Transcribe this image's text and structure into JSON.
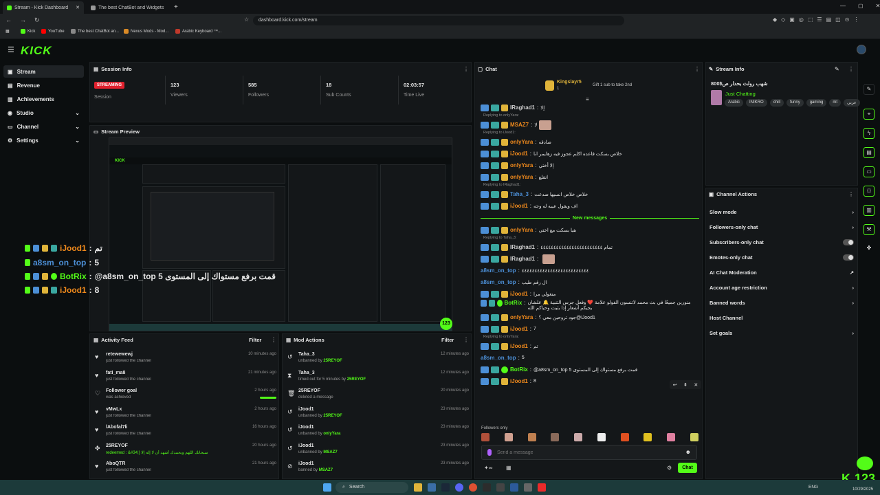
{
  "browser": {
    "tabs": [
      {
        "label": "Stream - Kick Dashboard"
      },
      {
        "label": "The best ChatBot and Widgets for Ki"
      }
    ],
    "url": "dashboard.kick.com/stream",
    "bookmarks": [
      "Kick",
      "YouTube",
      "The best ChatBot an...",
      "Nexus Mods - Mod...",
      "Arabic Keyboard ™..."
    ]
  },
  "app": {
    "logo": "KICK"
  },
  "sidebar": {
    "items": [
      {
        "label": "Stream"
      },
      {
        "label": "Revenue"
      },
      {
        "label": "Achievements"
      },
      {
        "label": "Studio"
      },
      {
        "label": "Channel"
      },
      {
        "label": "Settings"
      }
    ]
  },
  "session": {
    "title": "Session Info",
    "status": "STREAMING",
    "status_label": "Session",
    "stats": [
      {
        "value": "123",
        "label": "Viewers"
      },
      {
        "value": "585",
        "label": "Followers"
      },
      {
        "value": "18",
        "label": "Sub Counts"
      },
      {
        "value": "02:03:57",
        "label": "Time Live"
      }
    ]
  },
  "preview": {
    "title": "Stream Preview",
    "viewer_count": "123"
  },
  "overlay": [
    {
      "user": "iJood1",
      "text": "تم"
    },
    {
      "user": "a8sm_on_top",
      "text": "5"
    },
    {
      "user": "BotRix",
      "text": "@a8sm_on_top 5 قمت برفع مستواك إلى المستوى"
    },
    {
      "user": "iJood1",
      "text": "8"
    }
  ],
  "activity": {
    "title": "Activity Feed",
    "filter": "Filter",
    "items": [
      {
        "name": "retewewewj",
        "sub": "just followed the channel",
        "time": "10 minutes ago"
      },
      {
        "name": "fati_ma8",
        "sub": "just followed the channel",
        "time": "21 minutes ago"
      },
      {
        "name": "Follower goal",
        "sub": "was achieved",
        "time": "2 hours ago"
      },
      {
        "name": "vMwLx",
        "sub": "just followed the channel",
        "time": "2 hours ago"
      },
      {
        "name": "lAbofal7li",
        "sub": "just followed the channel",
        "time": "16 hours ago"
      },
      {
        "name": "25REYOF",
        "sub": "redeemed : &#34;} سبحانك اللهم وبحمدك أشهد أن لا إله إلا",
        "time": "20 hours ago"
      },
      {
        "name": "AboQTR",
        "sub": "just followed the channel",
        "time": "21 hours ago"
      }
    ]
  },
  "mod": {
    "title": "Mod Actions",
    "filter": "Filter",
    "items": [
      {
        "name": "Taha_3",
        "sub": "unbanned by",
        "by": "25REYOF",
        "time": "12 minutes ago"
      },
      {
        "name": "Taha_3",
        "sub": "timed out for 5 minutes by",
        "by": "25REYOF",
        "time": "12 minutes ago"
      },
      {
        "name": "25REYOF",
        "sub": "deleted a message",
        "by": "",
        "time": "20 minutes ago"
      },
      {
        "name": "iJood1",
        "sub": "unbanned by",
        "by": "25REYOF",
        "time": "23 minutes ago"
      },
      {
        "name": "iJood1",
        "sub": "unbanned by",
        "by": "onlyYara",
        "time": "23 minutes ago"
      },
      {
        "name": "iJood1",
        "sub": "unbanned by",
        "by": "MSAZ7",
        "time": "23 minutes ago"
      },
      {
        "name": "iJood1",
        "sub": "banned by",
        "by": "MSAZ7",
        "time": "23 minutes ago"
      }
    ]
  },
  "chat": {
    "title": "Chat",
    "pinned_user": "Kingslayr5",
    "pinned_sub": "Gift 1 sub to take 2nd",
    "pinned_count": "1",
    "new_messages": "New messages",
    "followers_only": "Followers only",
    "placeholder": "Send a message",
    "send": "Chat",
    "messages": [
      {
        "user": "IRaghad1",
        "color": "#cfcfcf",
        "text": "إلا",
        "reply": ""
      },
      {
        "user": "MSAZ7",
        "color": "#f08a1c",
        "text": "لا",
        "reply": "Replying to onlyYara:"
      },
      {
        "user": "onlyYara",
        "color": "#f08a1c",
        "text": "صادقه",
        "reply": "Replying to iJood1:"
      },
      {
        "user": "iJood1",
        "color": "#f08a1c",
        "text": "خلاص بسكت قاعده اكلم عجوز فيه زهايمر انا",
        "reply": ""
      },
      {
        "user": "onlyYara",
        "color": "#f08a1c",
        "text": "إلا أختي",
        "reply": ""
      },
      {
        "user": "onlyYara",
        "color": "#f08a1c",
        "text": "انقلع",
        "reply": ""
      },
      {
        "user": "Taha_3",
        "color": "#4c8fd6",
        "text": "خلاص خلاص انسيها صدعت",
        "reply": "Replying to IRaghad1:"
      },
      {
        "user": "iJood1",
        "color": "#f08a1c",
        "text": "اف ويقول عيبه له وجه",
        "reply": ""
      },
      {
        "user": "onlyYara",
        "color": "#f08a1c",
        "text": "هيا بسكت مع اختي",
        "reply": ""
      },
      {
        "user": "IRaghad1",
        "color": "#cfcfcf",
        "text": "تمام ٤٤٤٤٤٤٤٤٤٤٤٤٤٤٤٤٤٤٤٤٤٤٤٤",
        "reply": "Replying to Taha_3:"
      },
      {
        "user": "IRaghad1",
        "color": "#cfcfcf",
        "text": "",
        "reply": ""
      },
      {
        "user": "a8sm_on_top",
        "color": "#4c8fd6",
        "text": "٤٤٤٤٤٤٤٤٤٤٤٤٤٤٤٤٤٤٤٤٤٤٤٤٤٤",
        "reply": ""
      },
      {
        "user": "a8sm_on_top",
        "color": "#4c8fd6",
        "text": "ال رقم طيب",
        "reply": ""
      },
      {
        "user": "iJood1",
        "color": "#f08a1c",
        "text": "منغولي مرا",
        "reply": ""
      },
      {
        "user": "BotRix",
        "color": "#53fc18",
        "text": "منورين جميعًا في بث محمد لاتنسون الفولو علامة ❤️ وفعل جرس التنبية 🔔 علشان يجيكم أشعار إذا بثيت وحياكم الله",
        "reply": ""
      },
      {
        "user": "onlyYara",
        "color": "#f08a1c",
        "text": "جود تروحين معي ؟@iJood1",
        "reply": ""
      },
      {
        "user": "iJood1",
        "color": "#f08a1c",
        "text": "7",
        "reply": ""
      },
      {
        "user": "iJood1",
        "color": "#f08a1c",
        "text": "تم",
        "reply": "Replying to onlyYara:"
      },
      {
        "user": "a8sm_on_top",
        "color": "#4c8fd6",
        "text": "5",
        "reply": ""
      },
      {
        "user": "BotRix",
        "color": "#53fc18",
        "text": "@a8sm_on_top 5 قمت برفع مستواك إلى المستوى",
        "reply": ""
      },
      {
        "user": "iJood1",
        "color": "#f08a1c",
        "text": "8",
        "reply": ""
      }
    ]
  },
  "streaminfo": {
    "title": "Stream Info",
    "stream_title": "شهب رولت بحدار ص$800",
    "category": "Just Chatting",
    "tags": [
      "Arabic",
      "INIKRO",
      "chill",
      "funny",
      "gaming",
      "mt",
      "عربي"
    ]
  },
  "actions": {
    "title": "Channel Actions",
    "items": [
      {
        "label": "Slow mode",
        "kind": "arrow"
      },
      {
        "label": "Followers-only chat",
        "kind": "arrow"
      },
      {
        "label": "Subscribers-only chat",
        "kind": "toggle"
      },
      {
        "label": "Emotes-only chat",
        "kind": "toggle"
      },
      {
        "label": "AI Chat Moderation",
        "kind": "link"
      },
      {
        "label": "Account age restriction",
        "kind": "arrow"
      },
      {
        "label": "Banned words",
        "kind": "arrow"
      },
      {
        "label": "Host Channel",
        "kind": "none"
      },
      {
        "label": "Set goals",
        "kind": "arrow"
      }
    ]
  },
  "corner": {
    "count": "123"
  },
  "taskbar": {
    "search": "Search",
    "lang": "ENG",
    "date": "10/29/2025"
  },
  "colors": {
    "kick_green": "#53fc18",
    "streaming_red": "#e0212e",
    "orange": "#f08a1c",
    "blue": "#4c8fd6"
  }
}
